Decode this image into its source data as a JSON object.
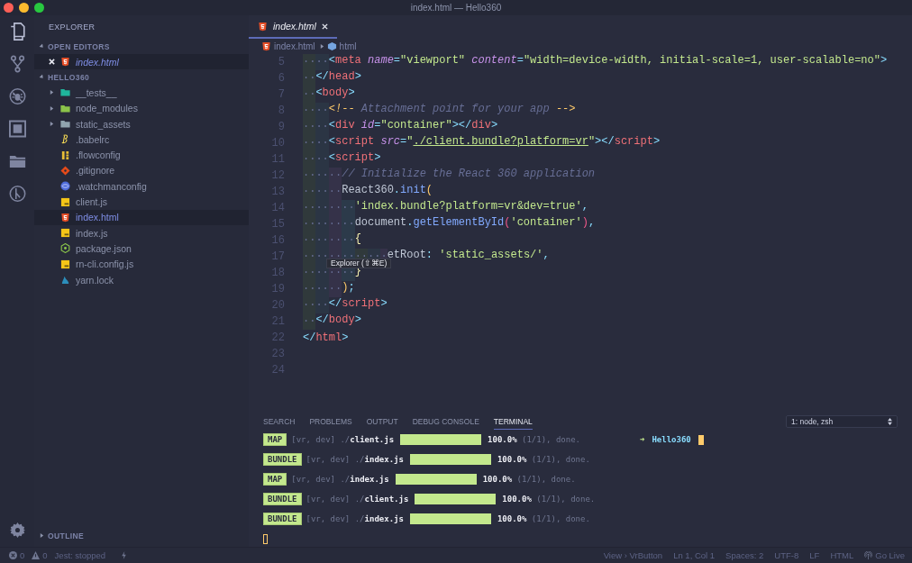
{
  "window": {
    "title": "index.html — Hello360"
  },
  "sidebar": {
    "title": "EXPLORER",
    "sections": [
      {
        "title": "OPEN EDITORS",
        "expanded": true,
        "items": [
          {
            "kind": "html",
            "label": "index.html",
            "selected": true,
            "preview": true,
            "closable": true
          }
        ]
      },
      {
        "title": "HELLO360",
        "expanded": true,
        "items": [
          {
            "kind": "folder",
            "label": "__tests__",
            "color": "#1fb59c",
            "expanded": false,
            "selected": false
          },
          {
            "kind": "folder",
            "label": "node_modules",
            "color": "#8bc34a",
            "expanded": false,
            "selected": false
          },
          {
            "kind": "folder",
            "label": "static_assets",
            "color": "#90a4ae",
            "expanded": false,
            "selected": false
          },
          {
            "kind": "babel",
            "label": ".babelrc",
            "selected": false
          },
          {
            "kind": "flow",
            "label": ".flowconfig",
            "selected": false
          },
          {
            "kind": "git",
            "label": ".gitignore",
            "selected": false
          },
          {
            "kind": "watchman",
            "label": ".watchmanconfig",
            "selected": false
          },
          {
            "kind": "js",
            "label": "client.js",
            "selected": false
          },
          {
            "kind": "html",
            "label": "index.html",
            "selected": true
          },
          {
            "kind": "js",
            "label": "index.js",
            "selected": false
          },
          {
            "kind": "node",
            "label": "package.json",
            "selected": false
          },
          {
            "kind": "js",
            "label": "rn-cli.config.js",
            "selected": false
          },
          {
            "kind": "yarn",
            "label": "yarn.lock",
            "selected": false
          }
        ]
      }
    ],
    "outline": {
      "title": "OUTLINE",
      "expanded": false
    }
  },
  "tabs": [
    {
      "label": "index.html",
      "selected": true,
      "preview": true
    }
  ],
  "breadcrumb": [
    {
      "kind": "html",
      "label": "index.html"
    },
    {
      "kind": "element",
      "label": "html"
    }
  ],
  "editor": {
    "lines": [
      {
        "number": "5",
        "tokens": [
          {
            "kind": "ws",
            "text": "····"
          },
          {
            "kind": "bracket",
            "text": "<"
          },
          {
            "kind": "tag",
            "text": "meta "
          },
          {
            "kind": "attr",
            "text": "name"
          },
          {
            "kind": "op",
            "text": "="
          },
          {
            "kind": "string",
            "text": "\"viewport\" "
          },
          {
            "kind": "attr",
            "text": "content"
          },
          {
            "kind": "op",
            "text": "="
          },
          {
            "kind": "string",
            "text": "\"width=device-width, initial-scale=1, user-scalable=no\""
          },
          {
            "kind": "bracket",
            "text": ">"
          }
        ]
      },
      {
        "number": "6",
        "tokens": [
          {
            "kind": "ws",
            "text": "··"
          },
          {
            "kind": "bracket",
            "text": "</"
          },
          {
            "kind": "tag",
            "text": "head"
          },
          {
            "kind": "bracket",
            "text": ">"
          }
        ]
      },
      {
        "number": "7",
        "tokens": [
          {
            "kind": "ws",
            "text": "··"
          },
          {
            "kind": "bracket",
            "text": "<"
          },
          {
            "kind": "tag",
            "text": "body"
          },
          {
            "kind": "bracket",
            "text": ">"
          }
        ]
      },
      {
        "number": "8",
        "tokens": [
          {
            "kind": "ws",
            "text": "····"
          },
          {
            "kind": "comment-mark",
            "text": "<!--"
          },
          {
            "kind": "comment",
            "text": " Attachment point for your app "
          },
          {
            "kind": "comment-mark",
            "text": "-->"
          }
        ]
      },
      {
        "number": "9",
        "tokens": [
          {
            "kind": "ws",
            "text": "····"
          },
          {
            "kind": "bracket",
            "text": "<"
          },
          {
            "kind": "tag",
            "text": "div "
          },
          {
            "kind": "attr",
            "text": "id"
          },
          {
            "kind": "op",
            "text": "="
          },
          {
            "kind": "string",
            "text": "\"container\""
          },
          {
            "kind": "bracket",
            "text": "></"
          },
          {
            "kind": "tag",
            "text": "div"
          },
          {
            "kind": "bracket",
            "text": ">"
          }
        ]
      },
      {
        "number": "10",
        "tokens": [
          {
            "kind": "ws",
            "text": "····"
          },
          {
            "kind": "bracket",
            "text": "<"
          },
          {
            "kind": "tag",
            "text": "script "
          },
          {
            "kind": "attr",
            "text": "src"
          },
          {
            "kind": "op",
            "text": "="
          },
          {
            "kind": "string",
            "text": "\""
          },
          {
            "kind": "link",
            "text": "./client.bundle?platform=vr"
          },
          {
            "kind": "string",
            "text": "\""
          },
          {
            "kind": "bracket",
            "text": "></"
          },
          {
            "kind": "tag",
            "text": "script"
          },
          {
            "kind": "bracket",
            "text": ">"
          }
        ]
      },
      {
        "number": "11",
        "tokens": [
          {
            "kind": "ws",
            "text": "····"
          },
          {
            "kind": "bracket",
            "text": "<"
          },
          {
            "kind": "tag",
            "text": "script"
          },
          {
            "kind": "bracket",
            "text": ">"
          }
        ]
      },
      {
        "number": "12",
        "tokens": [
          {
            "kind": "ws",
            "text": "······"
          },
          {
            "kind": "comment",
            "text": "// Initialize the React 360 application"
          }
        ]
      },
      {
        "number": "13",
        "tokens": [
          {
            "kind": "ws",
            "text": "······"
          },
          {
            "kind": "plain",
            "text": "React360"
          },
          {
            "kind": "op",
            "text": "."
          },
          {
            "kind": "func",
            "text": "init"
          },
          {
            "kind": "paren",
            "text": "("
          }
        ]
      },
      {
        "number": "14",
        "tokens": [
          {
            "kind": "ws",
            "text": "········"
          },
          {
            "kind": "string",
            "text": "'index.bundle?platform=vr&dev=true'"
          },
          {
            "kind": "op",
            "text": ","
          }
        ]
      },
      {
        "number": "15",
        "tokens": [
          {
            "kind": "ws",
            "text": "········"
          },
          {
            "kind": "plain",
            "text": "document"
          },
          {
            "kind": "op",
            "text": "."
          },
          {
            "kind": "func",
            "text": "getElementById"
          },
          {
            "kind": "paren2",
            "text": "("
          },
          {
            "kind": "string",
            "text": "'container'"
          },
          {
            "kind": "paren2",
            "text": ")"
          },
          {
            "kind": "op",
            "text": ","
          }
        ]
      },
      {
        "number": "16",
        "tokens": [
          {
            "kind": "ws",
            "text": "········"
          },
          {
            "kind": "brace",
            "text": "{"
          }
        ]
      },
      {
        "number": "17",
        "tokens": [
          {
            "kind": "ws",
            "text": "·············"
          },
          {
            "kind": "plain",
            "text": "etRoot"
          },
          {
            "kind": "op",
            "text": ": "
          },
          {
            "kind": "string",
            "text": "'static_assets/'"
          },
          {
            "kind": "op",
            "text": ","
          }
        ]
      },
      {
        "number": "18",
        "tokens": [
          {
            "kind": "ws",
            "text": "········"
          },
          {
            "kind": "brace",
            "text": "}"
          }
        ]
      },
      {
        "number": "19",
        "tokens": [
          {
            "kind": "ws",
            "text": "······"
          },
          {
            "kind": "paren",
            "text": ")"
          },
          {
            "kind": "op",
            "text": ";"
          }
        ]
      },
      {
        "number": "20",
        "tokens": [
          {
            "kind": "ws",
            "text": "····"
          },
          {
            "kind": "bracket",
            "text": "</"
          },
          {
            "kind": "tag",
            "text": "script"
          },
          {
            "kind": "bracket",
            "text": ">"
          }
        ]
      },
      {
        "number": "21",
        "tokens": [
          {
            "kind": "ws",
            "text": "··"
          },
          {
            "kind": "bracket",
            "text": "</"
          },
          {
            "kind": "tag",
            "text": "body"
          },
          {
            "kind": "bracket",
            "text": ">"
          }
        ]
      },
      {
        "number": "22",
        "tokens": [
          {
            "kind": "bracket",
            "text": "</"
          },
          {
            "kind": "tag",
            "text": "html"
          },
          {
            "kind": "bracket",
            "text": ">"
          }
        ]
      },
      {
        "number": "23"
      },
      {
        "number": "24"
      }
    ],
    "tooltip": "Explorer (⇧⌘E)"
  },
  "panel": {
    "tabs": [
      {
        "label": "SEARCH",
        "selected": false
      },
      {
        "label": "PROBLEMS",
        "selected": false
      },
      {
        "label": "OUTPUT",
        "selected": false
      },
      {
        "label": "DEBUG CONSOLE",
        "selected": false
      },
      {
        "label": "TERMINAL",
        "selected": true
      }
    ],
    "terminal_select": "1: node, zsh",
    "rows": [
      {
        "badge": "MAP",
        "path": "[vr, dev] ./**client.js**",
        "level": 1,
        "status": "**100.0%** (1/1), done."
      },
      {
        "badge": "BUNDLE",
        "path": "[vr, dev] ./**index.js**",
        "level": 1,
        "status": "**100.0%** (1/1), done."
      },
      {
        "badge": "MAP",
        "path": "[vr, dev] ./**index.js**",
        "level": 1,
        "status": "**100.0%** (1/1), done."
      },
      {
        "badge": "BUNDLE",
        "path": "[vr, dev] ./**client.js**",
        "level": 1,
        "status": "**100.0%** (1/1), done."
      },
      {
        "badge": "BUNDLE",
        "path": "[vr, dev] ./**index.js**",
        "level": 1,
        "status": "**100.0%** (1/1), done."
      }
    ],
    "prompt": {
      "symbol": "➜",
      "directory": "Hello360"
    }
  },
  "status_bar": {
    "left": [
      {
        "kind": "errors",
        "text": "0"
      },
      {
        "kind": "warnings",
        "text": "0"
      },
      {
        "kind": "text",
        "text": "Jest: stopped"
      },
      {
        "kind": "bolt"
      }
    ],
    "right": [
      {
        "kind": "text",
        "text": "View › VrButton"
      },
      {
        "kind": "text",
        "text": "Ln 1, Col 1"
      },
      {
        "kind": "text",
        "text": "Spaces: 2"
      },
      {
        "kind": "text",
        "text": "UTF-8"
      },
      {
        "kind": "text",
        "text": "LF"
      },
      {
        "kind": "text",
        "text": "HTML"
      },
      {
        "kind": "live",
        "text": "Go Live"
      }
    ]
  }
}
